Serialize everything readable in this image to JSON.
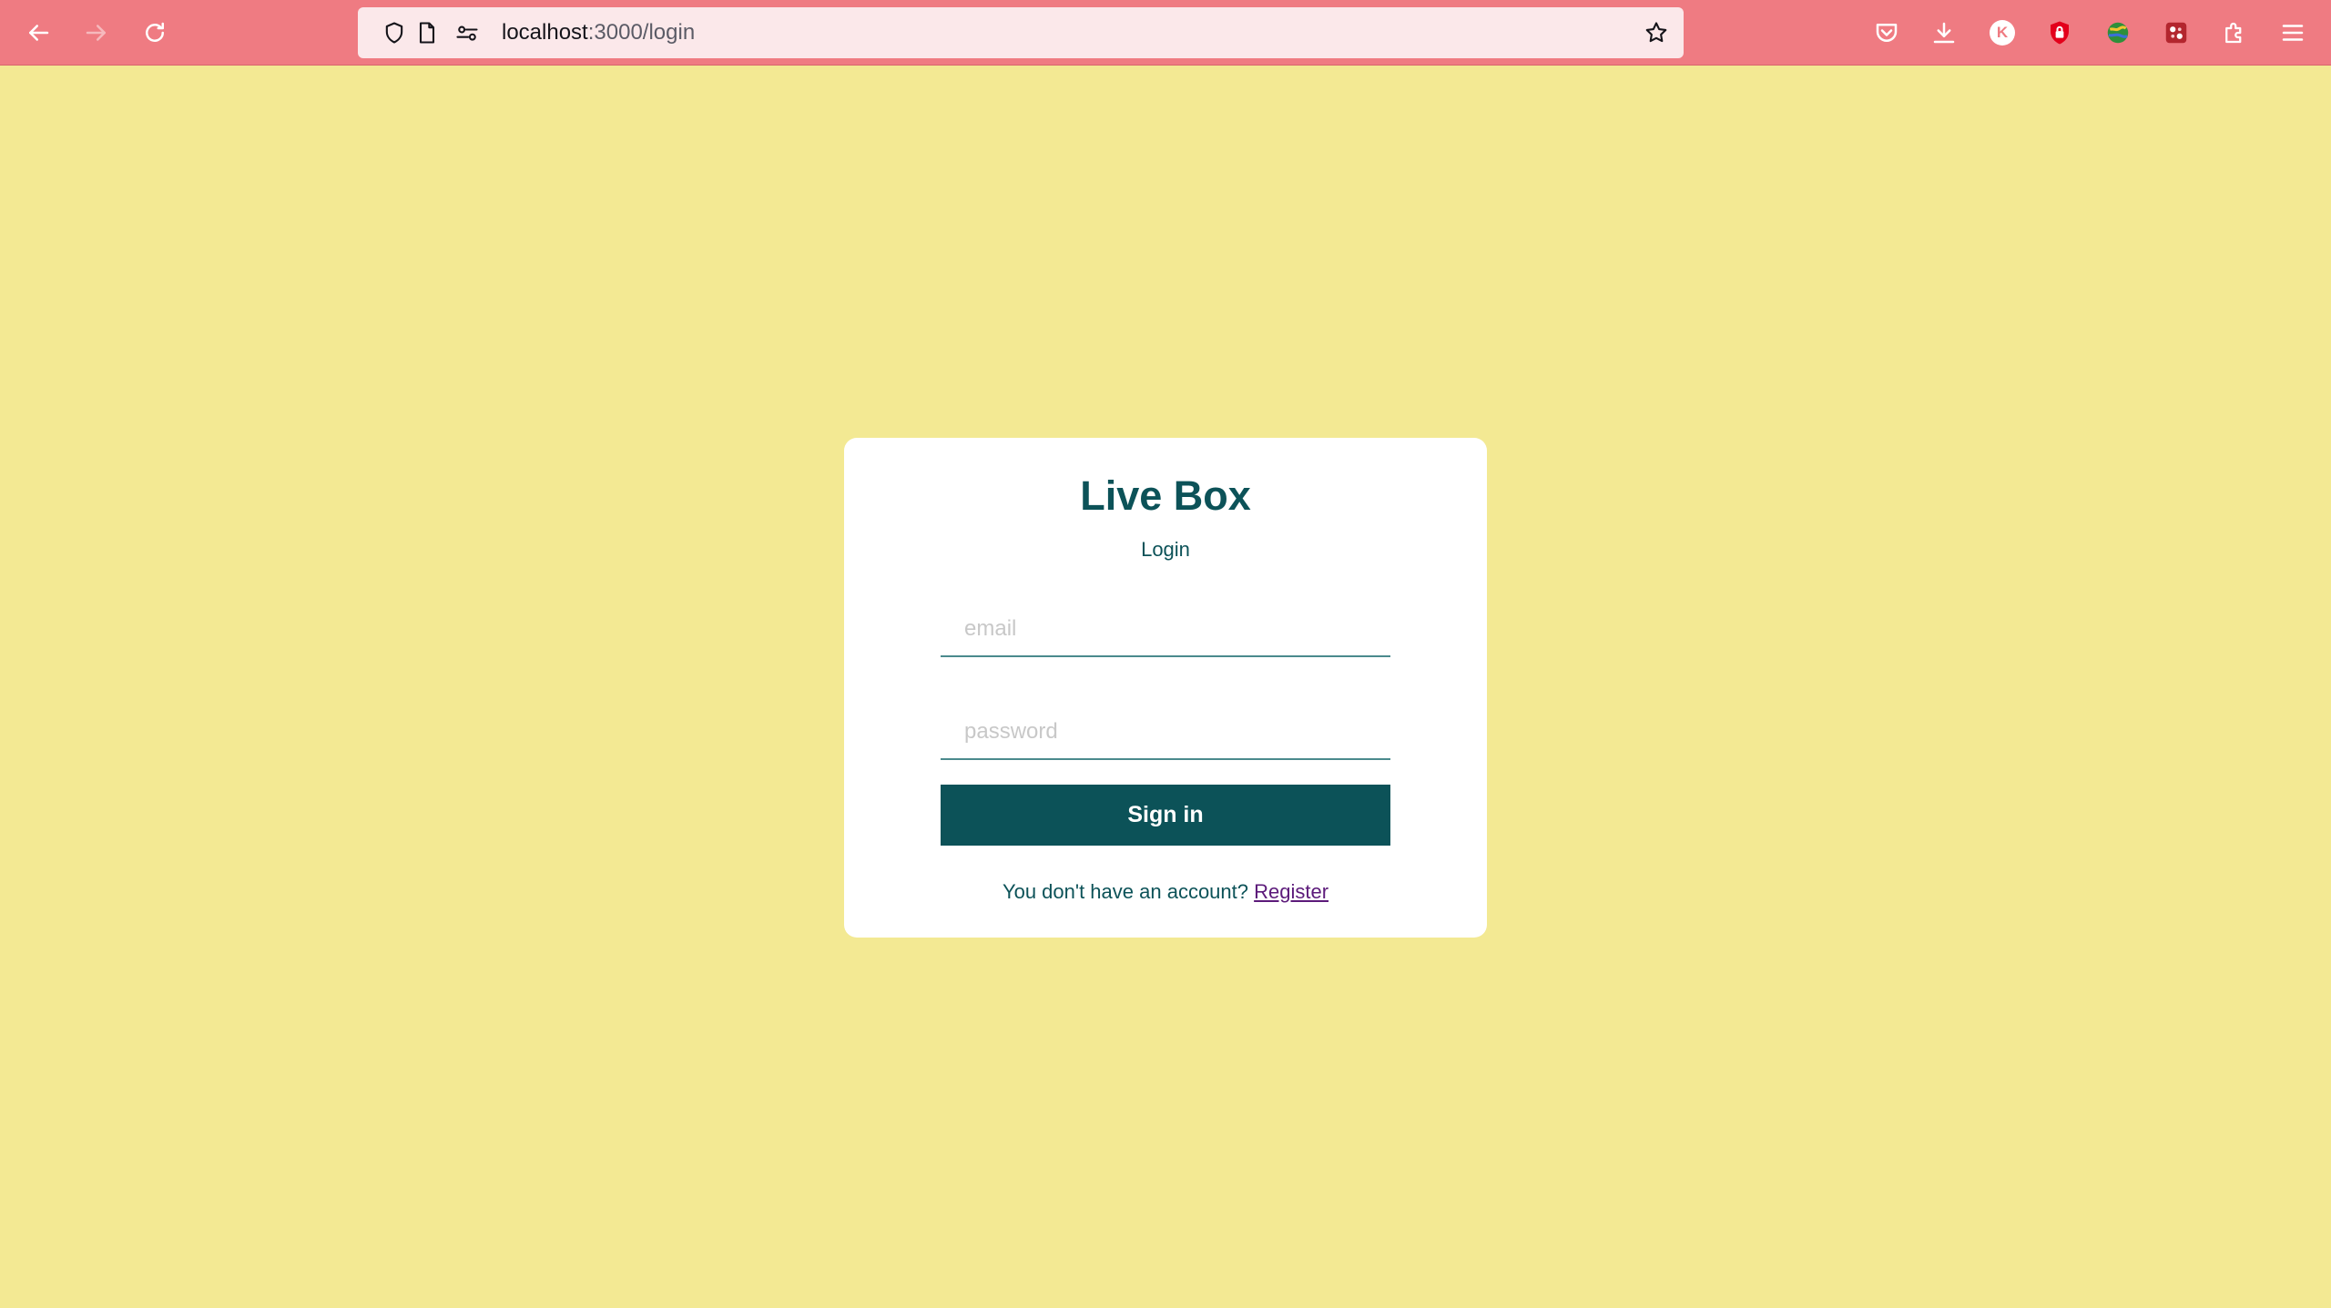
{
  "browser": {
    "url_host": "localhost",
    "url_path": ":3000/login",
    "profile_initial": "K"
  },
  "login": {
    "title": "Live Box",
    "subtitle": "Login",
    "email_placeholder": "email",
    "password_placeholder": "password",
    "signin_label": "Sign in",
    "footer_text": "You don't have an account?",
    "register_label": "Register"
  },
  "colors": {
    "toolbar": "#ef7b82",
    "background": "#f3e993",
    "primary": "#0c5258",
    "link": "#5c1a7a"
  },
  "icons": {
    "back": "back-arrow-icon",
    "forward": "forward-arrow-icon",
    "reload": "reload-icon",
    "shield": "shield-icon",
    "page": "page-icon",
    "permissions": "permissions-icon",
    "bookmark": "star-icon",
    "pocket": "pocket-icon",
    "downloads": "download-icon",
    "extension_lock": "lock-icon",
    "extension_globe": "globe-icon",
    "extension_puzzle": "extension-icon",
    "menu": "hamburger-menu-icon"
  }
}
